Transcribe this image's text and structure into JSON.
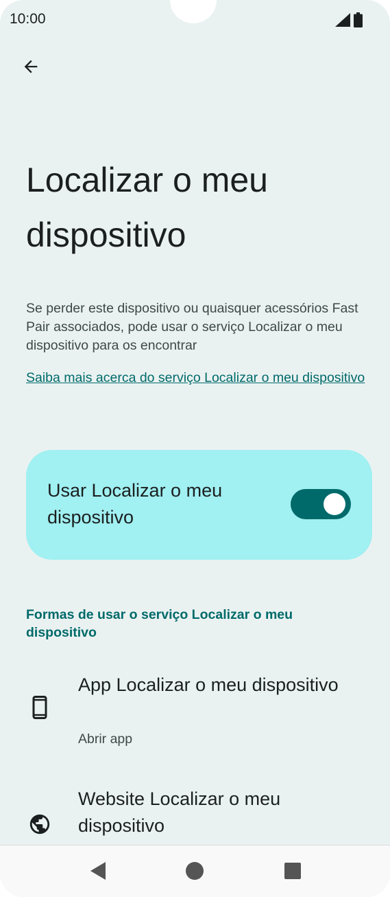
{
  "status_bar": {
    "time": "10:00"
  },
  "header": {
    "back_icon": "arrow-left-icon"
  },
  "page": {
    "title": "Localizar o meu dispositivo",
    "description": "Se perder este dispositivo ou quaisquer acessórios Fast Pair associados, pode usar o serviço Localizar o meu dispositivo para os encontrar",
    "learn_more_link": "Saiba mais acerca do serviço Localizar o meu dispositivo"
  },
  "main_toggle": {
    "label": "Usar Localizar o meu dispositivo",
    "state": "on",
    "accent_color": "#006a6a",
    "card_color": "#a1f0f2"
  },
  "section": {
    "header": "Formas de usar o serviço Localizar o meu dispositivo"
  },
  "list": {
    "items": [
      {
        "title": "App Localizar o meu dispositivo",
        "subtitle": "Abrir app",
        "icon": "smartphone-icon"
      },
      {
        "title": "Website Localizar o meu dispositivo",
        "icon": "globe-icon"
      }
    ]
  },
  "nav_bar": {
    "back": "triangle-back-icon",
    "home": "circle-home-icon",
    "recents": "square-recents-icon"
  }
}
